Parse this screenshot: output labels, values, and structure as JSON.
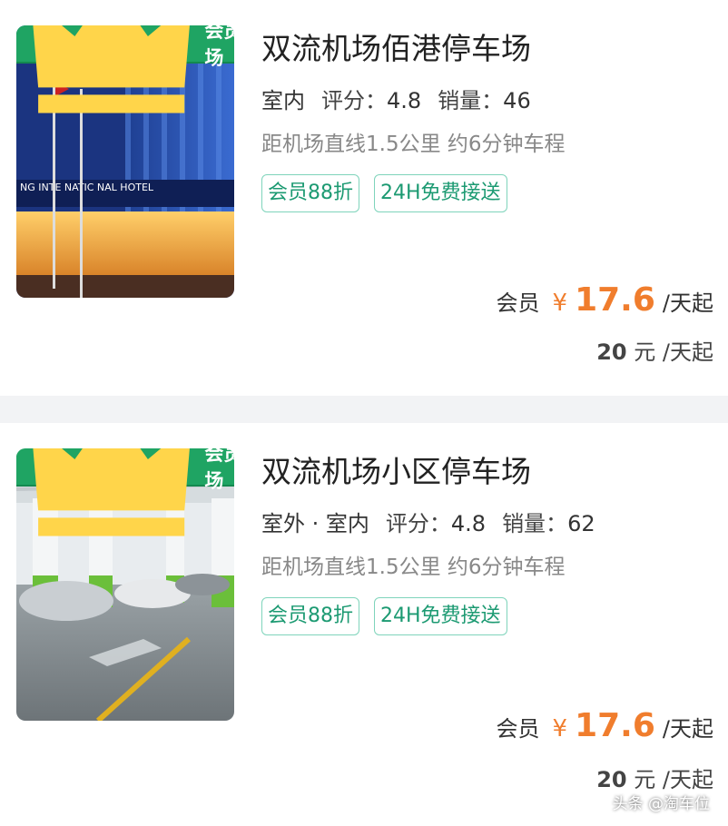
{
  "cards": [
    {
      "badge": "会员车场",
      "title": "双流机场佰港停车场",
      "type": "室内",
      "rating_label": "评分：",
      "rating": "4.8",
      "sales_label": "销量：",
      "sales": "46",
      "distance": "距机场直线1.5公里 约6分钟车程",
      "tags": [
        "会员88折",
        "24H免费接送"
      ],
      "price_label": "会员",
      "price_symbol": "¥",
      "price": "17.6",
      "price_unit": "/天起",
      "original_price": "20",
      "original_unit": "元 /天起",
      "photo_text": "NG INTE NATIC NAL HOTEL"
    },
    {
      "badge": "会员车场",
      "title": "双流机场小区停车场",
      "type": "室外 · 室内",
      "rating_label": "评分：",
      "rating": "4.8",
      "sales_label": "销量：",
      "sales": "62",
      "distance": "距机场直线1.5公里 约6分钟车程",
      "tags": [
        "会员88折",
        "24H免费接送"
      ],
      "price_label": "会员",
      "price_symbol": "¥",
      "price": "17.6",
      "price_unit": "/天起",
      "original_price": "20",
      "original_unit": "元 /天起"
    }
  ],
  "watermark": "头条 @淘车位",
  "colors": {
    "accent_green": "#1fa463",
    "price_orange": "#f07d2d",
    "tag_teal": "#1c9a72"
  },
  "icons": {
    "badge": "crown-icon"
  }
}
